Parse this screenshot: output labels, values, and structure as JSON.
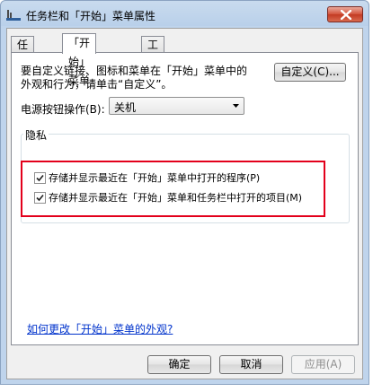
{
  "window": {
    "title": "任务栏和「开始」菜单属性"
  },
  "tabs": [
    {
      "label": "任务栏",
      "active": false
    },
    {
      "label": "「开始」菜单",
      "active": true
    },
    {
      "label": "工具栏",
      "active": false
    }
  ],
  "start_menu": {
    "description_line1": "要自定义链接、图标和菜单在「开始」菜单中的",
    "description_line2": "外观和行为，请单击“自定义”。",
    "customize_button": "自定义(C)...",
    "power_label": "电源按钮操作(B):",
    "power_value": "关机"
  },
  "privacy": {
    "group_label": "隐私",
    "options": [
      {
        "label": "存储并显示最近在「开始」菜单中打开的程序(P)",
        "checked": true
      },
      {
        "label": "存储并显示最近在「开始」菜单和任务栏中打开的项目(M)",
        "checked": true
      }
    ]
  },
  "help_link": "如何更改「开始」菜单的外观?",
  "footer": {
    "ok": "确定",
    "cancel": "取消",
    "apply": "应用(A)"
  },
  "colors": {
    "highlight_border": "#e3001b",
    "link": "#0033cc"
  }
}
